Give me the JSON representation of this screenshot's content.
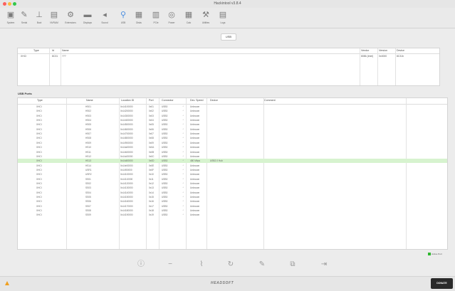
{
  "window": {
    "title": "Hackintool v3.8.4"
  },
  "toolbar": {
    "items": [
      {
        "label": "System",
        "icon": "system-icon"
      },
      {
        "label": "Serial",
        "icon": "pen-icon"
      },
      {
        "label": "Boot",
        "icon": "boot-icon"
      },
      {
        "label": "NVRAM",
        "icon": "nvram-icon"
      },
      {
        "label": "Extensions",
        "icon": "extensions-icon"
      },
      {
        "label": "Displays",
        "icon": "display-icon"
      },
      {
        "label": "Sound",
        "icon": "speaker-icon"
      },
      {
        "label": "USB",
        "icon": "usb-icon",
        "selected": true
      },
      {
        "label": "Disks",
        "icon": "disk-icon"
      },
      {
        "label": "PCIe",
        "icon": "pcie-icon"
      },
      {
        "label": "Power",
        "icon": "power-icon"
      },
      {
        "label": "Calc",
        "icon": "calculator-icon"
      },
      {
        "label": "Utilities",
        "icon": "wrench-icon"
      },
      {
        "label": "Logs",
        "icon": "logs-icon"
      }
    ]
  },
  "tab": {
    "label": "USB"
  },
  "top_table": {
    "headers": [
      "Type",
      "Id",
      "Name",
      "Vendor",
      "Version",
      "Device"
    ],
    "rows": [
      [
        "XHCI",
        "8C31",
        "???",
        "8086 (Intel)",
        "0x0000",
        "8C31h"
      ]
    ]
  },
  "usb_ports": {
    "title": "USB Ports",
    "headers": [
      "Type",
      "Name",
      "Location ID",
      "Port",
      "Connector",
      "Dev. Speed",
      "Device",
      "Comment"
    ],
    "rows": [
      [
        "XHCI",
        "HS01",
        "0x14100000",
        "0x01",
        "USB3",
        "Unknown",
        "",
        ""
      ],
      [
        "XHCI",
        "HS02",
        "0x14200000",
        "0x02",
        "USB3",
        "Unknown",
        "",
        ""
      ],
      [
        "XHCI",
        "HS03",
        "0x14300000",
        "0x03",
        "USB3",
        "Unknown",
        "",
        ""
      ],
      [
        "XHCI",
        "HS04",
        "0x14400000",
        "0x04",
        "USB3",
        "Unknown",
        "",
        ""
      ],
      [
        "XHCI",
        "HS05",
        "0x14500000",
        "0x05",
        "USB3",
        "Unknown",
        "",
        ""
      ],
      [
        "XHCI",
        "HS06",
        "0x14600000",
        "0x06",
        "USB3",
        "Unknown",
        "",
        ""
      ],
      [
        "XHCI",
        "HS07",
        "0x14700000",
        "0x07",
        "USB3",
        "Unknown",
        "",
        ""
      ],
      [
        "XHCI",
        "HS08",
        "0x14800000",
        "0x08",
        "USB3",
        "Unknown",
        "",
        ""
      ],
      [
        "XHCI",
        "HS09",
        "0x14900000",
        "0x09",
        "USB3",
        "Unknown",
        "",
        ""
      ],
      [
        "XHCI",
        "HS10",
        "0x14a00000",
        "0x0A",
        "USB3",
        "Unknown",
        "",
        ""
      ],
      [
        "XHCI",
        "HS11",
        "0x14b00000",
        "0x0B",
        "USB3",
        "Unknown",
        "",
        ""
      ],
      [
        "XHCI",
        "HS12",
        "0x14c00000",
        "0x0C",
        "USB3",
        "Unknown",
        "",
        ""
      ],
      [
        "XHCI",
        "HS13",
        "0x14d00000",
        "0x0D",
        "USB3",
        "480 Mbps",
        "USB2.0 Hub",
        ""
      ],
      [
        "XHCI",
        "HS14",
        "0x14e00000",
        "0x0E",
        "USB3",
        "Unknown",
        "",
        ""
      ],
      [
        "XHCI",
        "USR1",
        "0x14f00000",
        "0x0F",
        "USB3",
        "Unknown",
        "",
        ""
      ],
      [
        "XHCI",
        "USR2",
        "0x14100000",
        "0x10",
        "USB3",
        "Unknown",
        "",
        ""
      ],
      [
        "XHCI",
        "SS01",
        "0x14110000",
        "0x11",
        "USB3",
        "Unknown",
        "",
        ""
      ],
      [
        "XHCI",
        "SS02",
        "0x14120000",
        "0x12",
        "USB3",
        "Unknown",
        "",
        ""
      ],
      [
        "XHCI",
        "SS03",
        "0x14130000",
        "0x13",
        "USB3",
        "Unknown",
        "",
        ""
      ],
      [
        "XHCI",
        "SS04",
        "0x14140000",
        "0x14",
        "USB3",
        "Unknown",
        "",
        ""
      ],
      [
        "XHCI",
        "SS05",
        "0x14150000",
        "0x15",
        "USB3",
        "Unknown",
        "",
        ""
      ],
      [
        "XHCI",
        "SS06",
        "0x14160000",
        "0x16",
        "USB3",
        "Unknown",
        "",
        ""
      ],
      [
        "XHCI",
        "SS07",
        "0x14170000",
        "0x17",
        "USB3",
        "Unknown",
        "",
        ""
      ],
      [
        "XHCI",
        "SS08",
        "0x14180000",
        "0x18",
        "USB3",
        "Unknown",
        "",
        ""
      ],
      [
        "XHCI",
        "SS09",
        "0x14190000",
        "0x19",
        "USB3",
        "Unknown",
        "",
        ""
      ]
    ],
    "selected_row": 12
  },
  "legend": {
    "label": "Active Port",
    "color": "#2fb72f"
  },
  "bottom_actions": [
    {
      "name": "info-icon",
      "glyph": "ⓘ"
    },
    {
      "name": "remove-icon",
      "glyph": "−"
    },
    {
      "name": "brush-icon",
      "glyph": "⌇"
    },
    {
      "name": "refresh-icon",
      "glyph": "↻"
    },
    {
      "name": "edit-icon",
      "glyph": "✎"
    },
    {
      "name": "import-icon",
      "glyph": "⧉"
    },
    {
      "name": "export-icon",
      "glyph": "⇥"
    }
  ],
  "status": {
    "brand": "HEADSOFT",
    "warning_color": "#f0a020",
    "donate": "DONATE"
  },
  "colors": {
    "accent": "#4a8ee0",
    "selected_row": "#d7f3cf"
  }
}
